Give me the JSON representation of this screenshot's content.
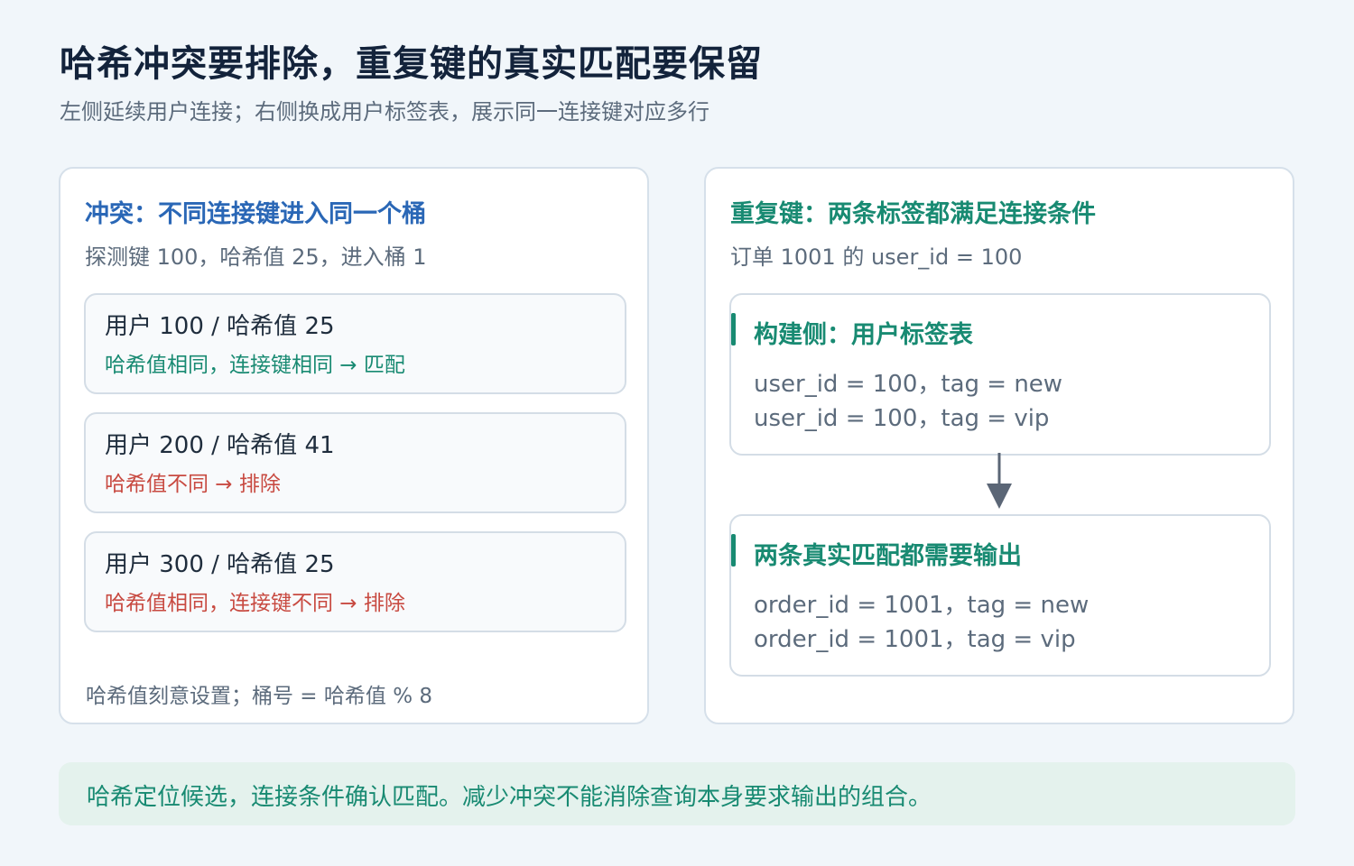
{
  "header": {
    "title": "哈希冲突要排除，重复键的真实匹配要保留",
    "subtitle": "左侧延续用户连接；右侧换成用户标签表，展示同一连接键对应多行"
  },
  "left_panel": {
    "title": "冲突：不同连接键进入同一个桶",
    "subtitle": "探测键 100，哈希值 25，进入桶 1",
    "rows": [
      {
        "label": "用户 100 / 哈希值 25",
        "result": "哈希值相同，连接键相同 → 匹配",
        "status": "match"
      },
      {
        "label": "用户 200 / 哈希值 41",
        "result": "哈希值不同 → 排除",
        "status": "excluded"
      },
      {
        "label": "用户 300 / 哈希值 25",
        "result": "哈希值相同，连接键不同 → 排除",
        "status": "excluded"
      }
    ],
    "note": "哈希值刻意设置；桶号 = 哈希值 % 8"
  },
  "right_panel": {
    "title": "重复键：两条标签都满足连接条件",
    "subtitle": "订单 1001 的 user_id = 100",
    "build_box": {
      "title": "构建侧：用户标签表",
      "lines": [
        "user_id = 100，tag = new",
        "user_id = 100，tag = vip"
      ]
    },
    "output_box": {
      "title": "两条真实匹配都需要输出",
      "lines": [
        "order_id = 1001，tag = new",
        "order_id = 1001，tag = vip"
      ]
    }
  },
  "footer": {
    "text": "哈希定位候选，连接条件确认匹配。减少冲突不能消除查询本身要求输出的组合。"
  },
  "colors": {
    "blue_title": "#2a67b6",
    "green_accent": "#188a72",
    "red_excluded": "#c84a41",
    "arrow": "#5b6676"
  }
}
